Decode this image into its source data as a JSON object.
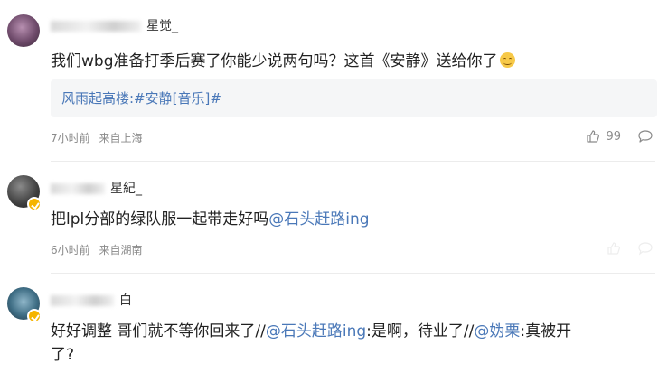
{
  "comments": [
    {
      "username_visible": "宝…  …",
      "username_tail": "星觉_",
      "text": "我们wbg准备打季后赛了你能少说两句吗？这首《安静》送给你了",
      "quote": "风雨起高楼:#安静[音乐]#",
      "time": "7小时前",
      "location": "来自上海",
      "likes": "99"
    },
    {
      "username_tail": "星紀_",
      "text_before": "把lpl分部的绿队服一起带走好吗",
      "mention": "@石头赶路ing",
      "time": "6小时前",
      "location": "来自湖南"
    },
    {
      "username_tail": "白",
      "line1_before": "好好调整 哥们就不等你回来了//",
      "mention1": "@石头赶路ing",
      "line1_mid": ":是啊，待业了//",
      "mention2": "@妫栗",
      "line1_after": ":真被开",
      "line2": "了?"
    }
  ],
  "colors": {
    "link": "#4a78b8",
    "badge": "#f5b400"
  }
}
